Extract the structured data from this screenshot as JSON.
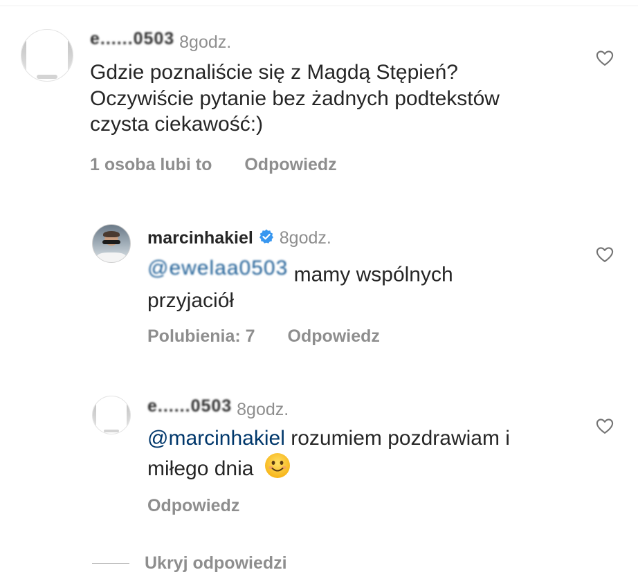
{
  "comments": [
    {
      "username": "e......0503",
      "time": "8godz.",
      "text": "Gdzie poznaliście się z Magdą Stępień? Oczywiście pytanie bez żadnych podtekstów czysta ciekawość:)",
      "likes_label": "1 osoba lubi to",
      "reply_label": "Odpowiedz",
      "like_icon": "heart-outline-icon"
    },
    {
      "username": "marcinhakiel",
      "verified": true,
      "time": "8godz.",
      "mention": "@ewelaa0503",
      "text": "mamy wspólnych przyjaciół",
      "likes_label": "Polubienia: 7",
      "reply_label": "Odpowiedz",
      "like_icon": "heart-outline-icon"
    },
    {
      "username": "e......0503",
      "time": "8godz.",
      "mention": "@marcinhakiel",
      "text": "rozumiem pozdrawiam i miłego dnia",
      "emoji": "smiling-face-icon",
      "reply_label": "Odpowiedz",
      "like_icon": "heart-outline-icon"
    }
  ],
  "hide_replies_label": "Ukryj odpowiedzi",
  "colors": {
    "text": "#262626",
    "secondary": "#8e8e8e",
    "mention": "#00376b",
    "verified": "#3897f0"
  }
}
